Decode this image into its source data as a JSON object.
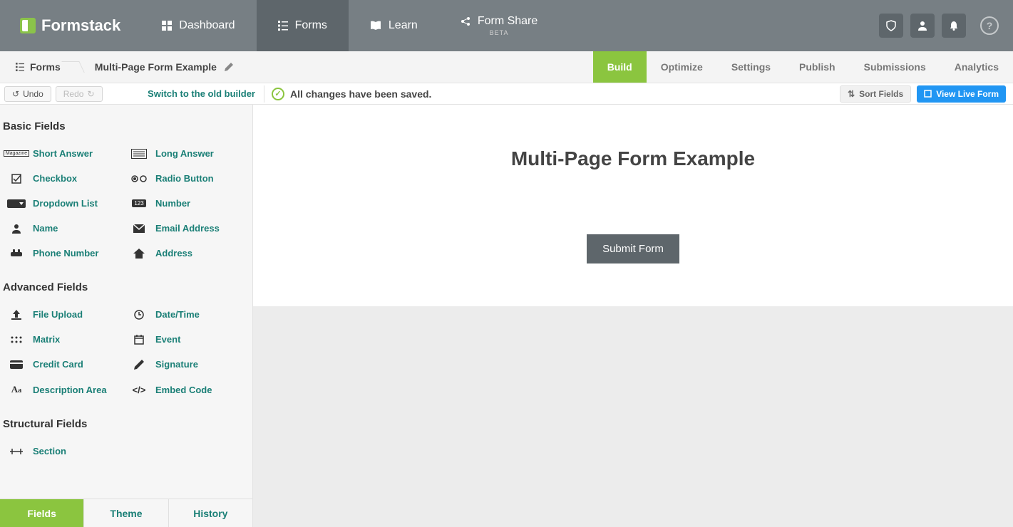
{
  "brand": "Formstack",
  "nav": {
    "dashboard": "Dashboard",
    "forms": "Forms",
    "learn": "Learn",
    "formshare": "Form Share",
    "beta": "BETA"
  },
  "breadcrumb": {
    "forms": "Forms",
    "title": "Multi-Page Form Example"
  },
  "subtabs": {
    "build": "Build",
    "optimize": "Optimize",
    "settings": "Settings",
    "publish": "Publish",
    "submissions": "Submissions",
    "analytics": "Analytics"
  },
  "toolbar": {
    "undo": "Undo",
    "redo": "Redo",
    "switch_old": "Switch to the old builder",
    "saved": "All changes have been saved.",
    "sort_fields": "Sort Fields",
    "view_live": "View Live Form"
  },
  "sections": {
    "basic": "Basic Fields",
    "advanced": "Advanced Fields",
    "structural": "Structural Fields"
  },
  "fields": {
    "short_answer": "Short Answer",
    "long_answer": "Long Answer",
    "checkbox": "Checkbox",
    "radio": "Radio Button",
    "dropdown": "Dropdown List",
    "number": "Number",
    "name": "Name",
    "email": "Email Address",
    "phone": "Phone Number",
    "address": "Address",
    "file_upload": "File Upload",
    "datetime": "Date/Time",
    "matrix": "Matrix",
    "event": "Event",
    "credit_card": "Credit Card",
    "signature": "Signature",
    "description": "Description Area",
    "embed": "Embed Code",
    "section": "Section"
  },
  "side_tabs": {
    "fields": "Fields",
    "theme": "Theme",
    "history": "History"
  },
  "form": {
    "title": "Multi-Page Form Example",
    "submit": "Submit Form"
  }
}
